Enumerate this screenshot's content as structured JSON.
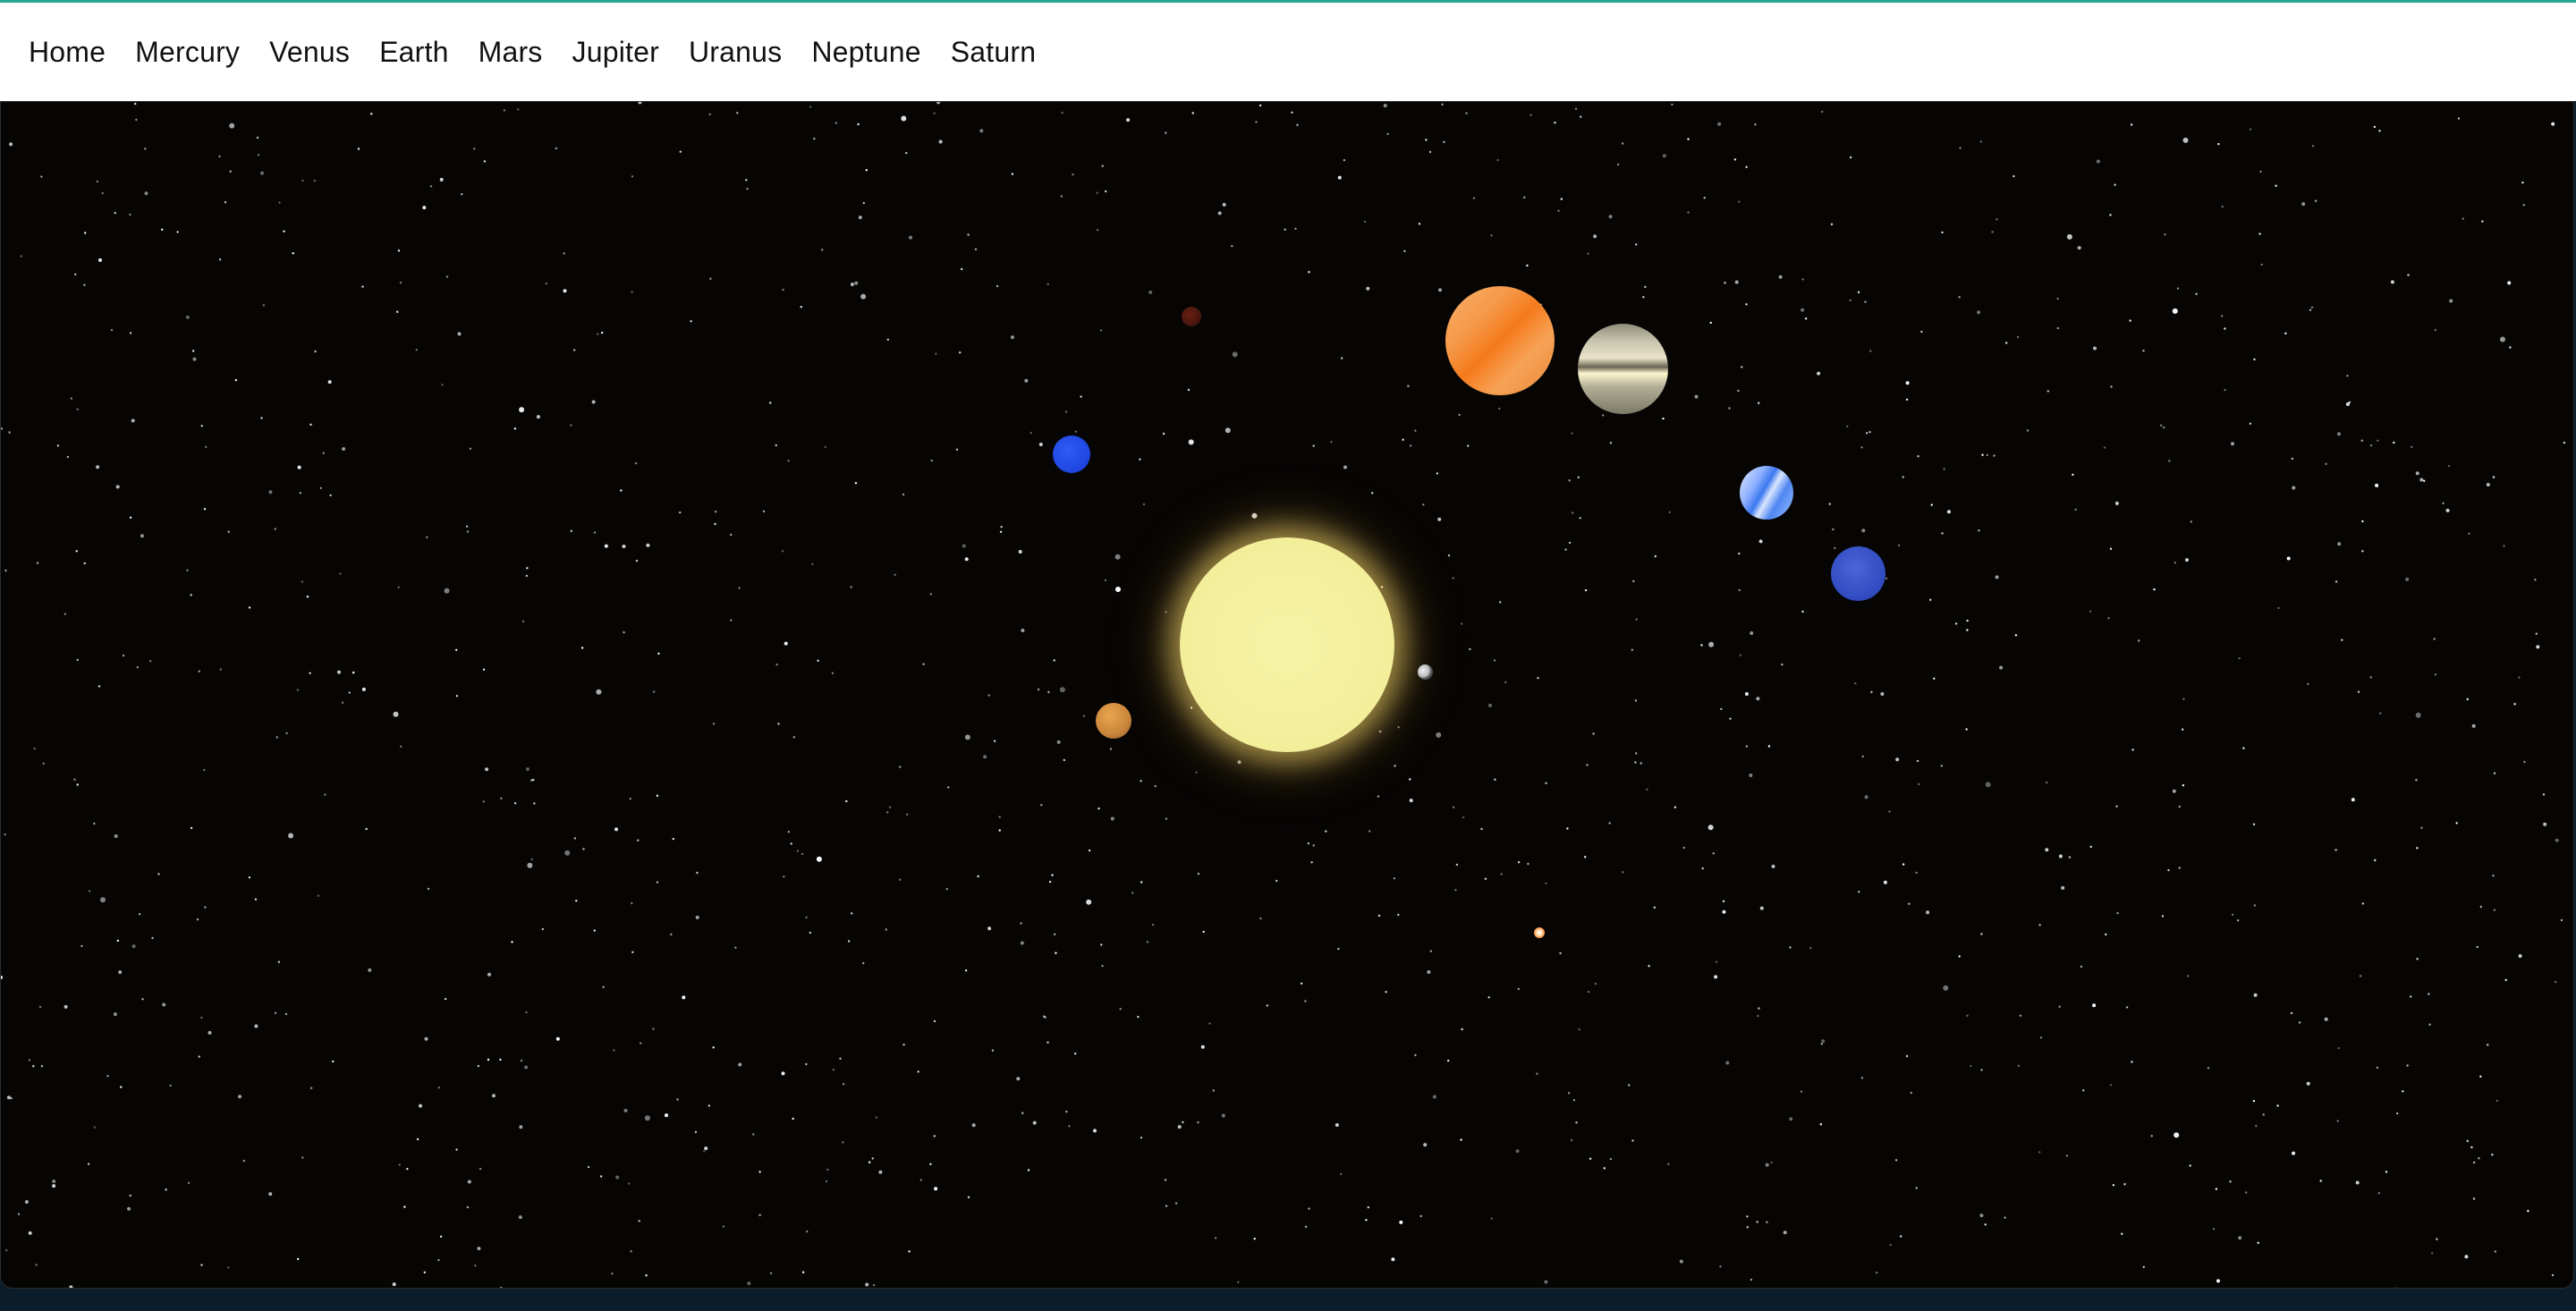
{
  "nav": {
    "items": [
      {
        "label": "Home"
      },
      {
        "label": "Mercury"
      },
      {
        "label": "Venus"
      },
      {
        "label": "Earth"
      },
      {
        "label": "Mars"
      },
      {
        "label": "Jupiter"
      },
      {
        "label": "Uranus"
      },
      {
        "label": "Neptune"
      },
      {
        "label": "Saturn"
      }
    ]
  },
  "colors": {
    "space_background": "#060504",
    "sun": "#f5f29c",
    "sun_glow": "#f0be46",
    "mercury": "#bdbdbd",
    "venus": "#c9853b",
    "earth": "#1f45e0",
    "mars": "#3d140c",
    "jupiter": "#f57a1c",
    "saturn": "#c9c6b0",
    "uranus": "#3b78f0",
    "neptune": "#324cc2"
  }
}
